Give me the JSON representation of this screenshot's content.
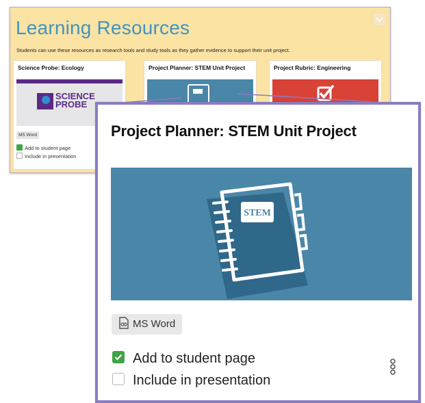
{
  "panel": {
    "title": "Learning Resources",
    "description": "Students can use these resources as research tools and study tools as they gather evidence to support their unit project.",
    "collapse_icon": "chevron-down-icon"
  },
  "cards": [
    {
      "title": "Science Probe: Ecology",
      "logo_text_1": "SCIENCE",
      "logo_text_2": "PROBE",
      "format": "MS Word",
      "add_label": "Add to student page",
      "add_checked": true,
      "present_label": "Include in presentation",
      "present_checked": false
    },
    {
      "title": "Project Planner: STEM Unit Project",
      "thumbnail_icon": "notebook-icon"
    },
    {
      "title": "Project Rubric: Engineering",
      "thumbnail_icon": "checkbox-icon"
    }
  ],
  "zoom": {
    "title": "Project Planner: STEM Unit Project",
    "notebook_label": "STEM",
    "format": "MS Word",
    "format_icon": "document-icon",
    "add_label": "Add to student page",
    "add_checked": true,
    "present_label": "Include in presentation",
    "present_checked": false,
    "link_icon": "link-icon"
  },
  "colors": {
    "panel_bg": "#fbe3a4",
    "title_blue": "#3f94c3",
    "stem_blue": "#4a86a7",
    "rubric_red": "#d94236",
    "science_purple": "#5b2a86",
    "zoom_border": "#8a7cc2",
    "check_green": "#3ea546"
  }
}
